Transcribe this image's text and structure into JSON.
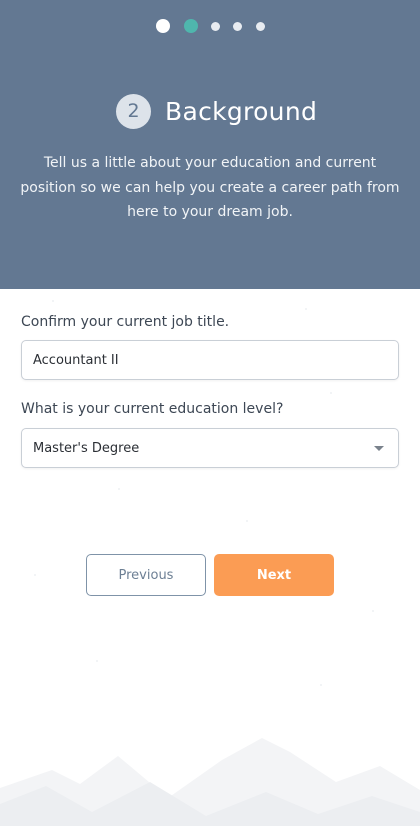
{
  "progress": {
    "total_steps": 5,
    "current_step": 2
  },
  "step": {
    "number": "2",
    "title": "Background",
    "description": "Tell us a little about your education and current position so we can help you create a career path from here to your dream job."
  },
  "form": {
    "job_title": {
      "label": "Confirm your current job title.",
      "value": "Accountant II"
    },
    "education": {
      "label": "What is your current education level?",
      "selected": "Master's Degree"
    }
  },
  "buttons": {
    "previous": "Previous",
    "next": "Next"
  },
  "colors": {
    "header_bg": "#637892",
    "active_dot": "#4fb6ad",
    "next_button": "#fb9c54",
    "previous_border": "#7f93a8"
  }
}
